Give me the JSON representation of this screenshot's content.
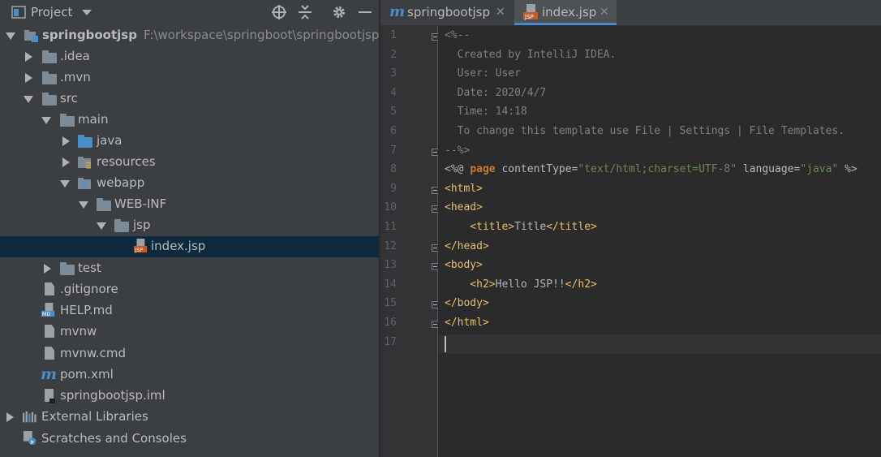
{
  "project_panel": {
    "title": "Project",
    "tree": [
      {
        "label": "springbootjsp",
        "path": "F:\\workspace\\springboot\\springbootjsp",
        "depth": 0,
        "expanded": true,
        "icon": "module-icon"
      },
      {
        "label": ".idea",
        "depth": 1,
        "expanded": false,
        "icon": "folder-icon"
      },
      {
        "label": ".mvn",
        "depth": 1,
        "expanded": false,
        "icon": "folder-icon"
      },
      {
        "label": "src",
        "depth": 1,
        "expanded": true,
        "icon": "folder-icon"
      },
      {
        "label": "main",
        "depth": 2,
        "expanded": true,
        "icon": "folder-icon"
      },
      {
        "label": "java",
        "depth": 3,
        "expanded": false,
        "icon": "source-folder-icon"
      },
      {
        "label": "resources",
        "depth": 3,
        "expanded": false,
        "icon": "resources-folder-icon"
      },
      {
        "label": "webapp",
        "depth": 3,
        "expanded": true,
        "icon": "web-folder-icon"
      },
      {
        "label": "WEB-INF",
        "depth": 4,
        "expanded": true,
        "icon": "folder-icon"
      },
      {
        "label": "jsp",
        "depth": 5,
        "expanded": true,
        "icon": "folder-icon"
      },
      {
        "label": "index.jsp",
        "depth": 6,
        "icon": "jsp-file-icon",
        "selected": true
      },
      {
        "label": "test",
        "depth": 2,
        "expanded": false,
        "icon": "folder-icon"
      },
      {
        "label": ".gitignore",
        "depth": 2,
        "icon": "file-icon"
      },
      {
        "label": "HELP.md",
        "depth": 2,
        "icon": "markdown-file-icon"
      },
      {
        "label": "mvnw",
        "depth": 2,
        "icon": "file-icon"
      },
      {
        "label": "mvnw.cmd",
        "depth": 2,
        "icon": "file-icon"
      },
      {
        "label": "pom.xml",
        "depth": 2,
        "icon": "maven-icon"
      },
      {
        "label": "springbootjsp.iml",
        "depth": 2,
        "icon": "iml-file-icon"
      },
      {
        "label": "External Libraries",
        "depth": 0,
        "expanded": false,
        "icon": "libraries-icon"
      },
      {
        "label": "Scratches and Consoles",
        "depth": 0,
        "icon": "scratches-icon"
      }
    ]
  },
  "tabs": [
    {
      "label": "springbootjsp",
      "icon": "maven-icon",
      "active": false
    },
    {
      "label": "index.jsp",
      "icon": "jsp-file-icon",
      "active": true
    }
  ],
  "editor": {
    "line_numbers": [
      "1",
      "2",
      "3",
      "4",
      "5",
      "6",
      "7",
      "8",
      "9",
      "10",
      "11",
      "12",
      "13",
      "14",
      "15",
      "16",
      "17"
    ],
    "lines": [
      [
        {
          "t": "<%--",
          "c": "com"
        }
      ],
      [
        {
          "t": "  Created by IntelliJ IDEA.",
          "c": "com"
        }
      ],
      [
        {
          "t": "  User: User",
          "c": "com"
        }
      ],
      [
        {
          "t": "  Date: 2020/4/7",
          "c": "com"
        }
      ],
      [
        {
          "t": "  Time: 14:18",
          "c": "com"
        }
      ],
      [
        {
          "t": "  To change this template use File | Settings | File Templates.",
          "c": "com"
        }
      ],
      [
        {
          "t": "--%>",
          "c": "com"
        }
      ],
      [
        {
          "t": "<%@ ",
          "c": "txt"
        },
        {
          "t": "page",
          "c": "kw"
        },
        {
          "t": " contentType=",
          "c": "attr"
        },
        {
          "t": "\"text/html;charset=UTF-8\"",
          "c": "str"
        },
        {
          "t": " language=",
          "c": "attr"
        },
        {
          "t": "\"java\"",
          "c": "str"
        },
        {
          "t": " %>",
          "c": "txt"
        }
      ],
      [
        {
          "t": "<html>",
          "c": "tag"
        }
      ],
      [
        {
          "t": "<head>",
          "c": "tag"
        }
      ],
      [
        {
          "t": "    <title>",
          "c": "tag"
        },
        {
          "t": "Title",
          "c": "txt"
        },
        {
          "t": "</title>",
          "c": "tag"
        }
      ],
      [
        {
          "t": "</head>",
          "c": "tag"
        }
      ],
      [
        {
          "t": "<body>",
          "c": "tag"
        }
      ],
      [
        {
          "t": "    <h2>",
          "c": "tag"
        },
        {
          "t": "Hello JSP!!",
          "c": "txt"
        },
        {
          "t": "</h2>",
          "c": "tag"
        }
      ],
      [
        {
          "t": "</body>",
          "c": "tag"
        }
      ],
      [
        {
          "t": "</html>",
          "c": "tag"
        }
      ],
      []
    ],
    "current_line": 17
  }
}
